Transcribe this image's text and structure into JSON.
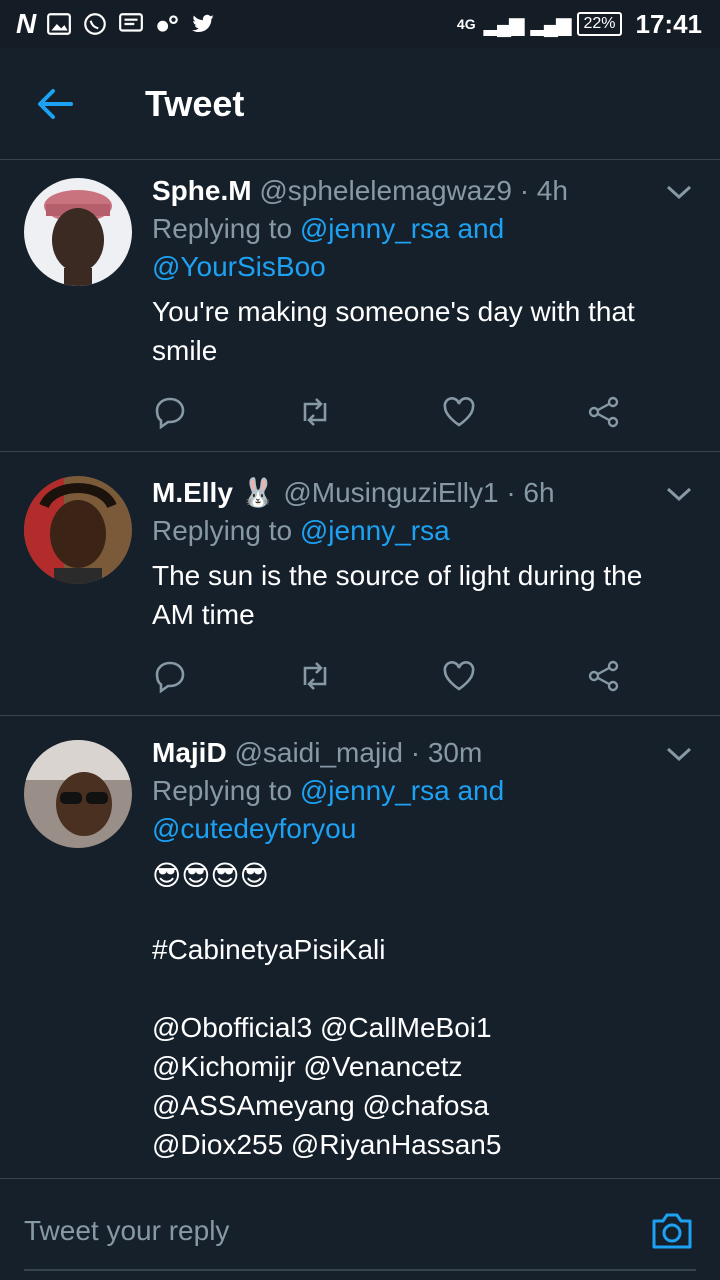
{
  "status_bar": {
    "network": "4G",
    "battery": "22%",
    "time": "17:41"
  },
  "header": {
    "title": "Tweet"
  },
  "tweets": [
    {
      "name": "Sphe.M",
      "handle": "@sphelelemagwaz9",
      "time": "· 4h",
      "replying_prefix": "Replying to ",
      "reply_line1": "@jenny_rsa and",
      "reply_line2": "@YourSisBoo",
      "text_line1": "You're making someone's day with that",
      "text_line2": "smile"
    },
    {
      "name": "M.Elly",
      "emoji": "🐰",
      "handle": "@MusinguziElly1",
      "time": "· 6h",
      "replying_prefix": "Replying to ",
      "reply_line1": "@jenny_rsa",
      "text_line1": "The sun is the source of light during the",
      "text_line2": "AM time"
    },
    {
      "name": "MajiD",
      "handle": "@saidi_majid",
      "time": "· 30m",
      "replying_prefix": "Replying to ",
      "reply_line1": "@jenny_rsa and",
      "reply_line2": "@cutedeyforyou",
      "emojis": "😎😎😎😎",
      "hashtag": "#CabinetyaPisiKali",
      "mention_lines": [
        "@Obofficial3 @CallMeBoi1",
        "@Kichomijr @Venancetz",
        "@ASSAmeyang @chafosa",
        "@Diox255 @RiyanHassan5"
      ]
    }
  ],
  "reply_bar": {
    "placeholder": "Tweet your reply"
  },
  "colors": {
    "background": "#15202b",
    "accent": "#1da1f2",
    "secondary_text": "#8899a6",
    "divider": "#38444d"
  }
}
